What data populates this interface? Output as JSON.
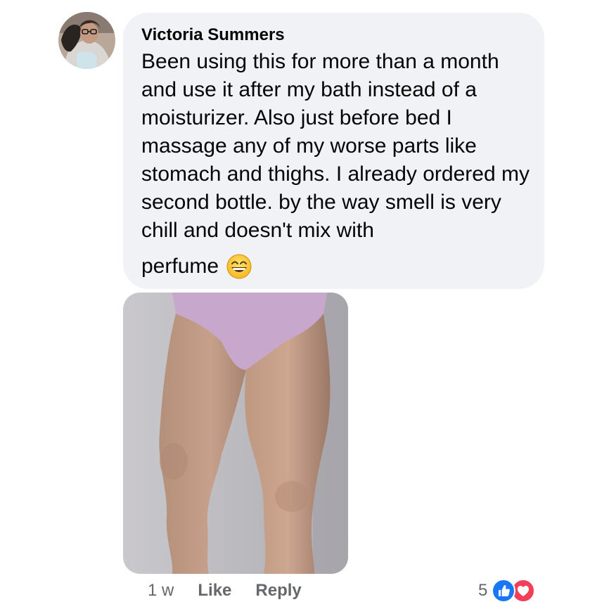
{
  "comment": {
    "author": "Victoria Summers",
    "text": "Been using this for more than a month and use it after my bath instead of a moisturizer. Also just before bed I massage any of my worse parts like stomach and thighs. I already ordered my second bottle. by the way smell is very chill and doesn't mix with",
    "text_last_line": "perfume",
    "emoji": "grinning-face-with-smiling-eyes"
  },
  "footer": {
    "time": "1 w",
    "like_label": "Like",
    "reply_label": "Reply"
  },
  "reactions": {
    "count": "5",
    "types": [
      "like",
      "love"
    ]
  },
  "colors": {
    "bubble": "#f0f2f5",
    "meta_text": "#65676b",
    "like": "#1877f2",
    "love": "#f33e58"
  }
}
